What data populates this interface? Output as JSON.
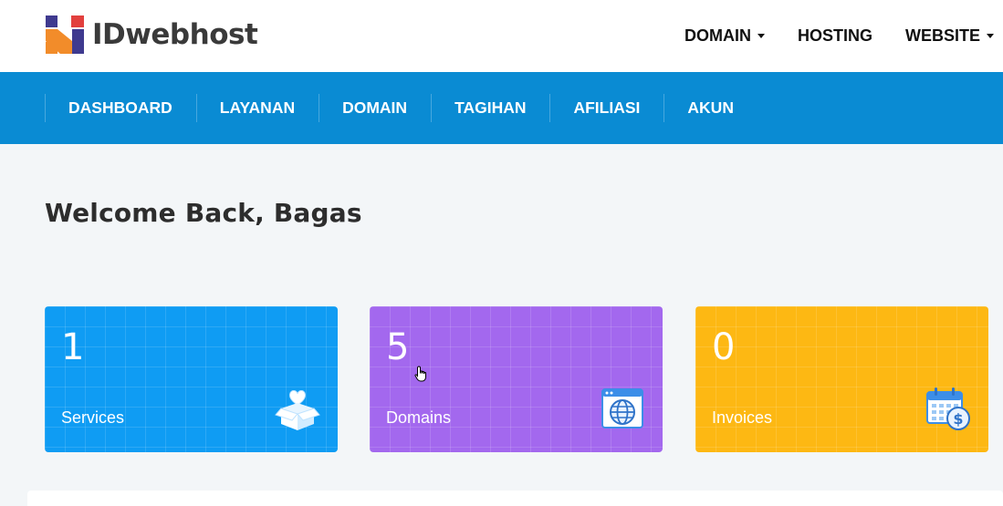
{
  "brand": {
    "name": "IDwebhost"
  },
  "topnav": [
    {
      "label": "DOMAIN",
      "dropdown": true
    },
    {
      "label": "HOSTING",
      "dropdown": false
    },
    {
      "label": "WEBSITE",
      "dropdown": true
    }
  ],
  "mainnav": [
    {
      "label": "DASHBOARD"
    },
    {
      "label": "LAYANAN"
    },
    {
      "label": "DOMAIN"
    },
    {
      "label": "TAGIHAN"
    },
    {
      "label": "AFILIASI"
    },
    {
      "label": "AKUN"
    }
  ],
  "welcome": {
    "title": "Welcome Back, Bagas"
  },
  "cards": [
    {
      "count": "1",
      "label": "Services",
      "icon": "box-heart-icon",
      "color": "#0f9cf3"
    },
    {
      "count": "5",
      "label": "Domains",
      "icon": "globe-browser-icon",
      "color": "#a368ee"
    },
    {
      "count": "0",
      "label": "Invoices",
      "icon": "calendar-dollar-icon",
      "color": "#fdb813"
    }
  ],
  "colors": {
    "nav_blue": "#0a8bd3",
    "page_bg": "#f3f6f8"
  }
}
